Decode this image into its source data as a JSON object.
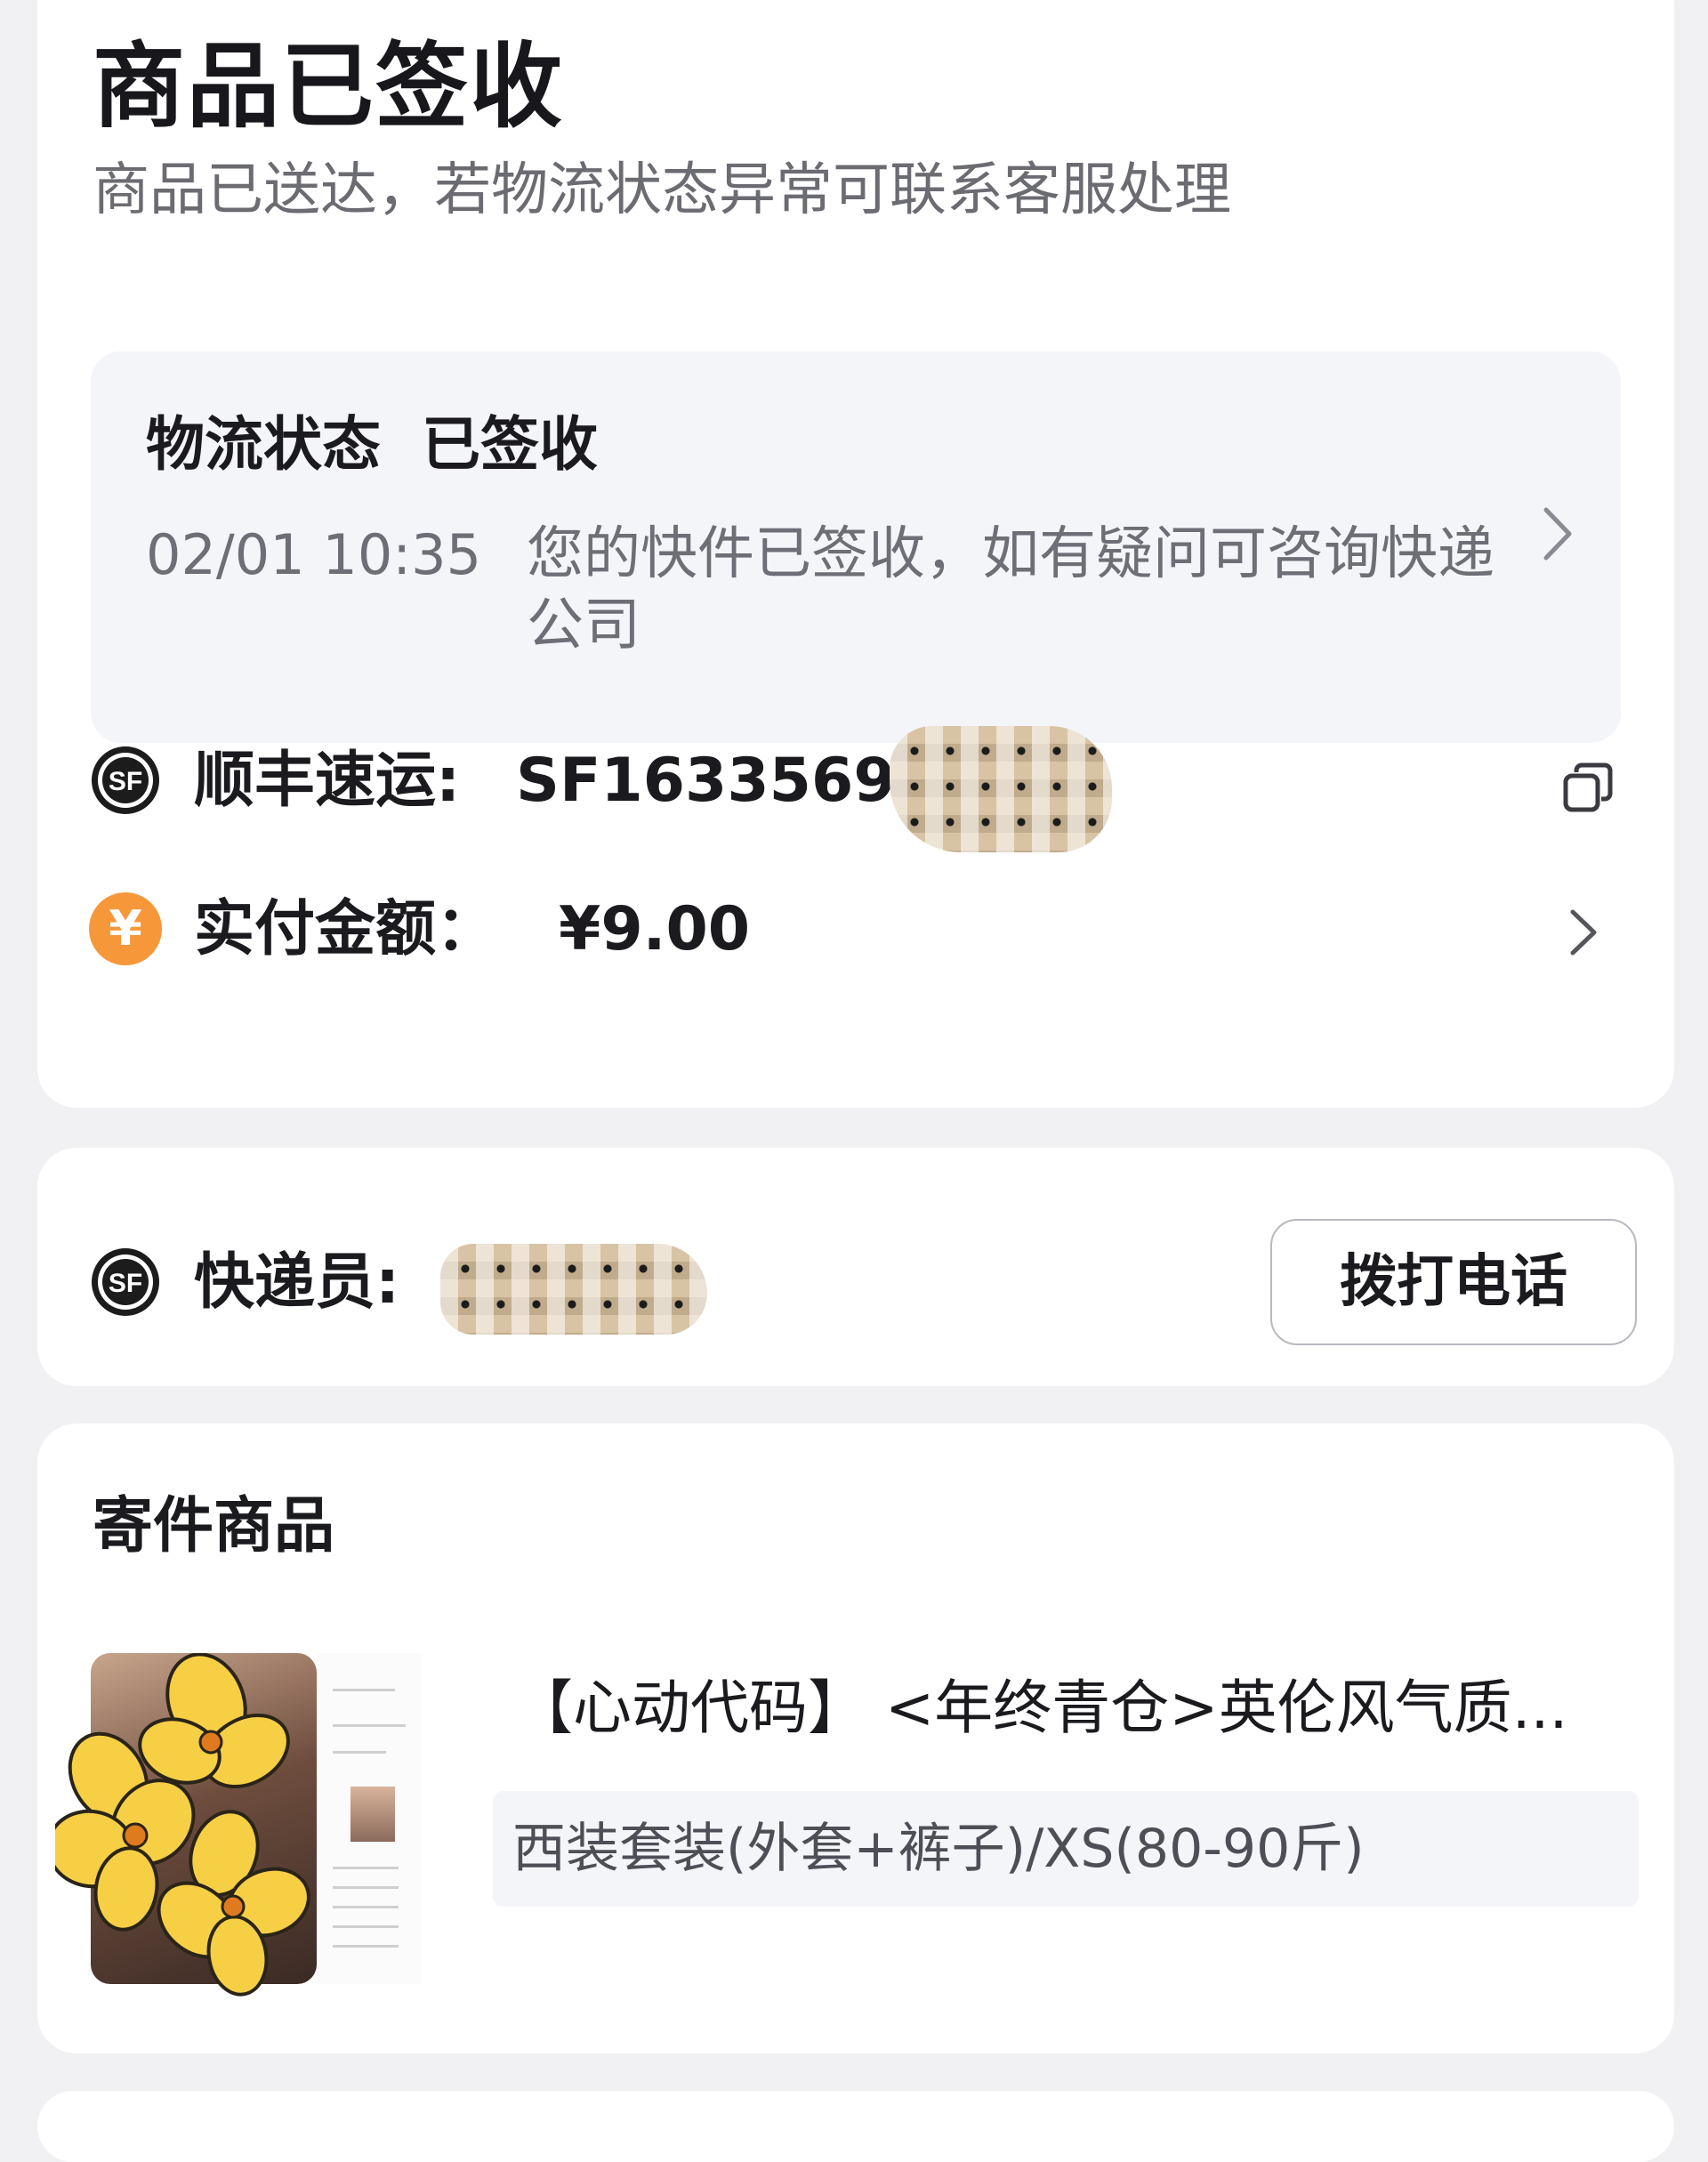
{
  "header": {
    "title": "商品已签收",
    "subtitle": "商品已送达，若物流状态异常可联系客服处理"
  },
  "logistics": {
    "label": "物流状态",
    "status": "已签收",
    "time": "02/01 10:35",
    "description": "您的快件已签收，如有疑问可咨询快递公司"
  },
  "tracking": {
    "icon": "sf-express-logo-icon",
    "label": "顺丰速运: ",
    "number_visible": "SF16335693",
    "number_redacted": true,
    "copy_icon": "copy-icon"
  },
  "payment": {
    "icon": "yen-icon",
    "label": "实付金额：",
    "amount": "¥9.00"
  },
  "courier": {
    "icon": "sf-express-logo-icon",
    "label": "快递员:",
    "name_redacted": true,
    "call_button": "拨打电话"
  },
  "goods": {
    "heading": "寄件商品",
    "items": [
      {
        "title": "【心动代码】 <年终青仓>英伦风气质...",
        "sku": "西装套装(外套+裤子)/XS(80-90斤)"
      }
    ]
  },
  "colors": {
    "page_background": "#f1f1f3",
    "card_background": "#ffffff",
    "panel_background": "#f4f5f9",
    "primary_text": "#1b1b1f",
    "secondary_text": "#6b6b72",
    "yen_orange": "#f6983a"
  }
}
